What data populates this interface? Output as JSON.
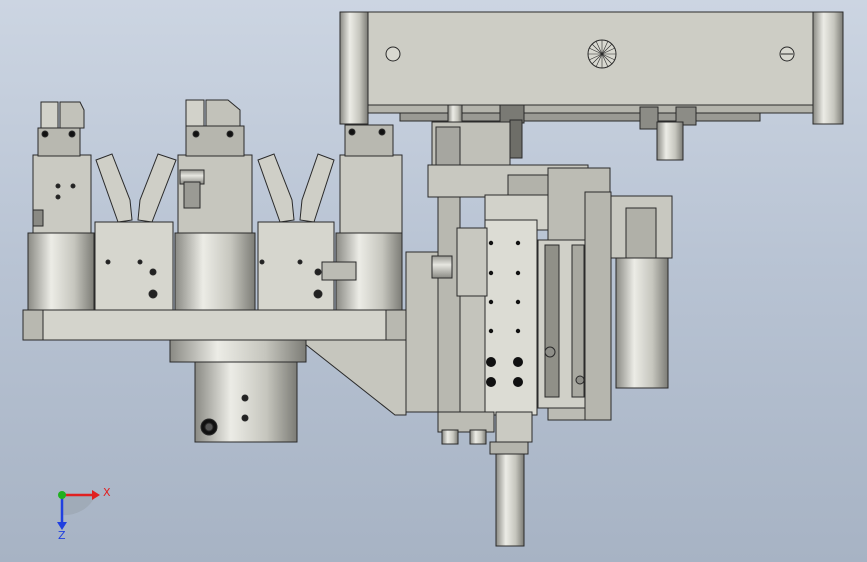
{
  "viewport": {
    "background_top": "#ccd5e2",
    "background_bottom": "#a7b3c4"
  },
  "triad": {
    "x_label": "X",
    "z_label": "Z",
    "x_color": "#e02020",
    "y_color": "#20b020",
    "z_color": "#2040e0"
  },
  "colors": {
    "body": "#c4c4bc",
    "body_light": "#dadad2",
    "body_dark": "#8e8e88",
    "edge": "#2a2a2a",
    "hole": "#111111"
  }
}
